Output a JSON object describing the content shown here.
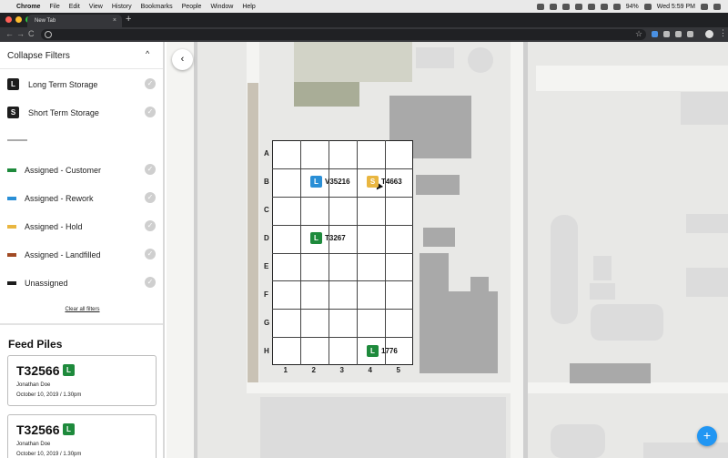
{
  "os_menubar": {
    "app": "Chrome",
    "menus": [
      "File",
      "Edit",
      "View",
      "History",
      "Bookmarks",
      "People",
      "Window",
      "Help"
    ],
    "battery": "94%",
    "clock": "Wed 5:59 PM"
  },
  "browser": {
    "tab_title": "New Tab",
    "new_tab_symbol": "+",
    "close_symbol": "×",
    "back_symbol": "←",
    "forward_symbol": "→",
    "reload_symbol": "C",
    "star_symbol": "☆",
    "menu_symbol": "⋮",
    "traffic_light_colors": [
      "#ff5f57",
      "#febc2e",
      "#28c840"
    ]
  },
  "filters": {
    "header_label": "Collapse Filters",
    "collapse_symbol": "^",
    "check_symbol": "✓",
    "storage_types": [
      {
        "badge": "L",
        "label": "Long Term Storage"
      },
      {
        "badge": "S",
        "label": "Short Term Storage"
      }
    ],
    "statuses": [
      {
        "label": "Assigned - Customer",
        "color": "#1e8a3c"
      },
      {
        "label": "Assigned - Rework",
        "color": "#2a8fd6"
      },
      {
        "label": "Assigned - Hold",
        "color": "#e9b640"
      },
      {
        "label": "Assigned - Landfilled",
        "color": "#a14a24"
      },
      {
        "label": "Unassigned",
        "color": "#1d1d1d"
      }
    ],
    "clear_all_label": "Clear all filters"
  },
  "feed_piles": {
    "title": "Feed Piles",
    "cards": [
      {
        "id": "T32566",
        "badge": "L",
        "name": "Jonathan Doe",
        "date": "October 10, 2019 / 1.30pm"
      },
      {
        "id": "T32566",
        "badge": "L",
        "name": "Jonathan Doe",
        "date": "October 10, 2019 / 1.30pm"
      }
    ]
  },
  "map": {
    "back_symbol": "‹",
    "add_symbol": "+",
    "grid": {
      "rows": [
        "A",
        "B",
        "C",
        "D",
        "E",
        "F",
        "G",
        "H"
      ],
      "columns": [
        "1",
        "2",
        "3",
        "4",
        "5"
      ]
    },
    "piles": [
      {
        "badge": "L",
        "label": "V35216",
        "color": "#2a8fd6",
        "row": "B",
        "col": 2
      },
      {
        "badge": "S",
        "label": "T4663",
        "color": "#e9b640",
        "row": "B",
        "col": 4
      },
      {
        "badge": "L",
        "label": "T3267",
        "color": "#1e8a3c",
        "row": "D",
        "col": 2
      },
      {
        "badge": "L",
        "label": "1776",
        "color": "#1e8a3c",
        "row": "H",
        "col": 4
      }
    ]
  }
}
